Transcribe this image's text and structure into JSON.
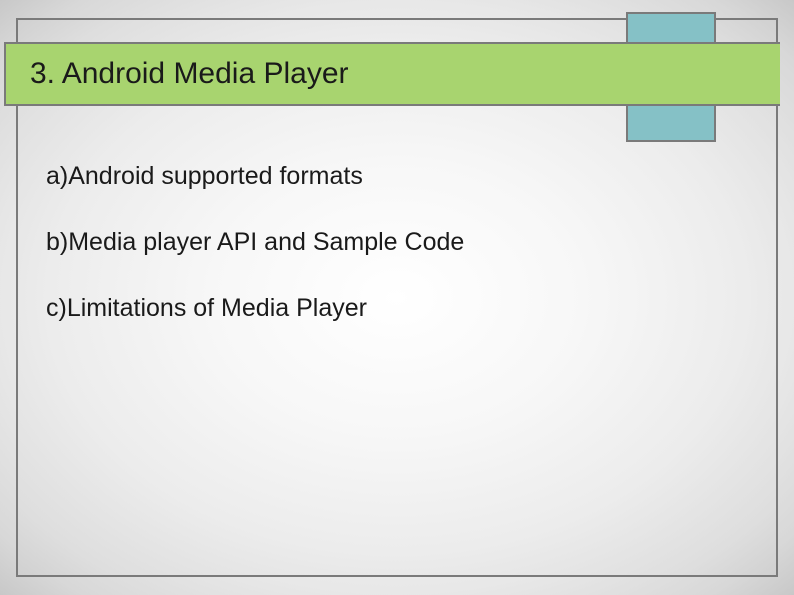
{
  "title": "3. Android Media Player",
  "bullets": {
    "a": "a)Android supported formats",
    "b": "b)Media player API and Sample Code",
    "c": "c)Limitations of Media Player"
  }
}
